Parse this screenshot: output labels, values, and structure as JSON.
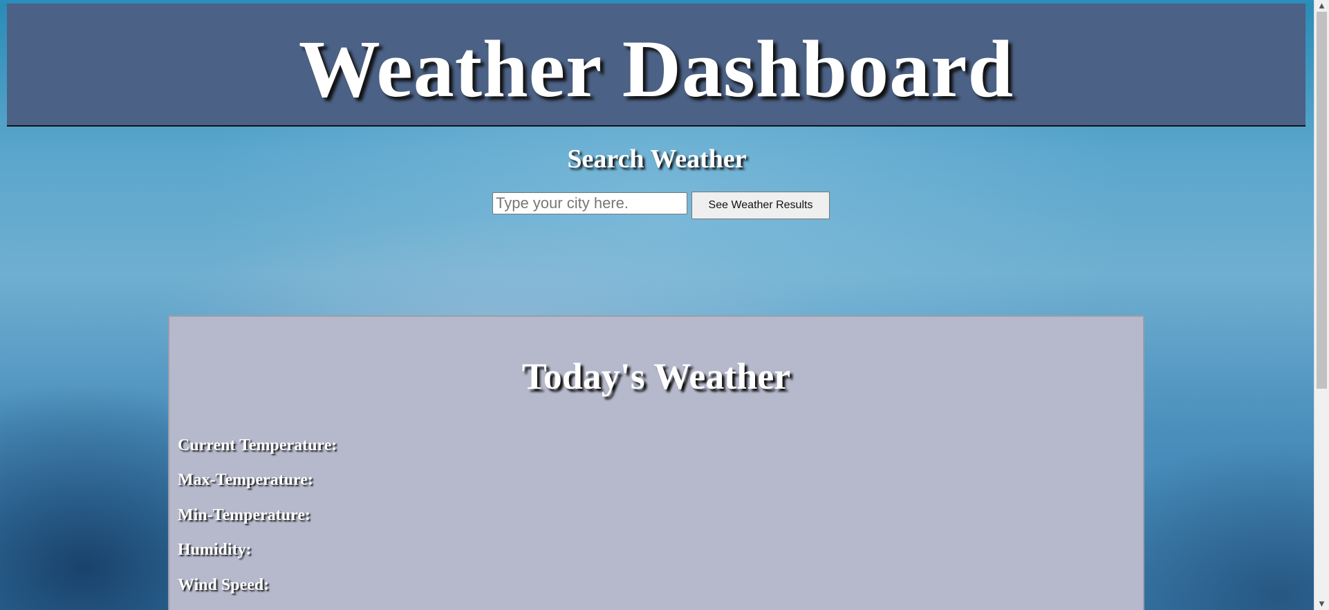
{
  "header": {
    "title": "Weather Dashboard"
  },
  "search": {
    "title": "Search Weather",
    "placeholder": "Type your city here.",
    "value": "",
    "button_label": "See Weather Results"
  },
  "today": {
    "title": "Today's Weather",
    "stats": [
      {
        "label": "Current Temperature:"
      },
      {
        "label": "Max-Temperature:"
      },
      {
        "label": "Min-Temperature:"
      },
      {
        "label": "Humidity:"
      },
      {
        "label": "Wind Speed:"
      }
    ]
  },
  "scrollbar": {
    "up_icon": "chevron-up-icon",
    "down_icon": "chevron-down-icon"
  }
}
